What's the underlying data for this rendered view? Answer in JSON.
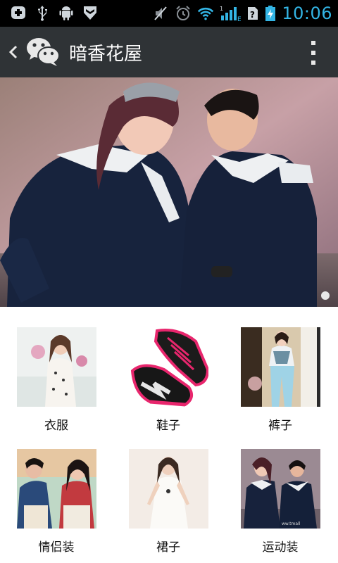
{
  "status_bar": {
    "time": "10:06",
    "network": "E",
    "sim_slot": "1",
    "time_color": "#33b5e5",
    "icons_left": [
      "add-icon",
      "usb-icon",
      "android-icon",
      "shield-icon"
    ],
    "icons_right": [
      "mute-icon",
      "alarm-icon",
      "wifi-icon",
      "signal-icon",
      "sim-icon",
      "battery-icon"
    ]
  },
  "action_bar": {
    "title": "暗香花屋",
    "background": "#2f3336",
    "icons": [
      "back-icon",
      "wechat-icon",
      "overflow-menu-icon"
    ]
  },
  "banner": {
    "indicator_count": 1
  },
  "categories": [
    {
      "label": "衣服"
    },
    {
      "label": "鞋子"
    },
    {
      "label": "裤子"
    },
    {
      "label": "情侣装"
    },
    {
      "label": "裙子"
    },
    {
      "label": "运动装"
    }
  ]
}
